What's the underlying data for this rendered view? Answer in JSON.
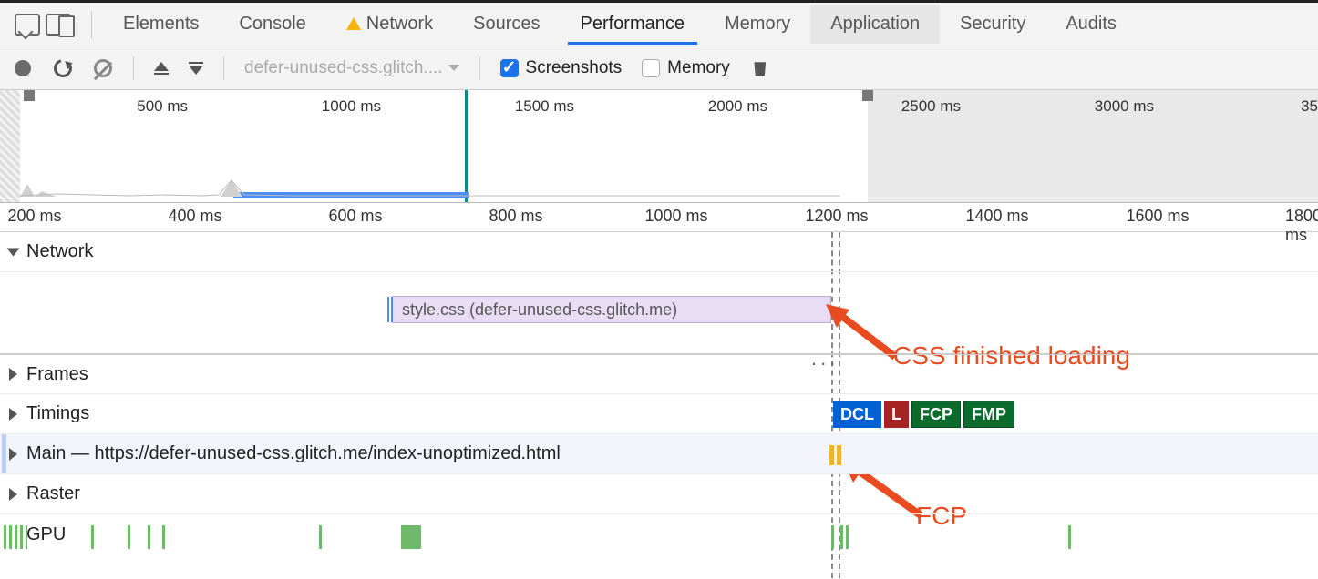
{
  "tabs": {
    "elements": "Elements",
    "console": "Console",
    "network": "Network",
    "sources": "Sources",
    "performance": "Performance",
    "memory": "Memory",
    "application": "Application",
    "security": "Security",
    "audits": "Audits"
  },
  "toolbar": {
    "recording_label": "defer-unused-css.glitch....",
    "screenshots_label": "Screenshots",
    "screenshots_checked": true,
    "memory_label": "Memory",
    "memory_checked": false
  },
  "overview": {
    "ticks": [
      "500 ms",
      "1000 ms",
      "1500 ms",
      "2000 ms",
      "2500 ms",
      "3000 ms",
      "35"
    ]
  },
  "ruler": {
    "ticks": [
      "200 ms",
      "400 ms",
      "600 ms",
      "800 ms",
      "1000 ms",
      "1200 ms",
      "1400 ms",
      "1600 ms",
      "1800 ms"
    ]
  },
  "rows": {
    "network": "Network",
    "frames": "Frames",
    "timings": "Timings",
    "main": "Main — https://defer-unused-css.glitch.me/index-unoptimized.html",
    "raster": "Raster",
    "gpu": "GPU"
  },
  "network_request": {
    "label": "style.css (defer-unused-css.glitch.me)"
  },
  "timings_badges": {
    "dcl": "DCL",
    "l": "L",
    "fcp": "FCP",
    "fmp": "FMP"
  },
  "annotations": {
    "css_finished": "CSS finished loading",
    "fcp": "FCP"
  }
}
